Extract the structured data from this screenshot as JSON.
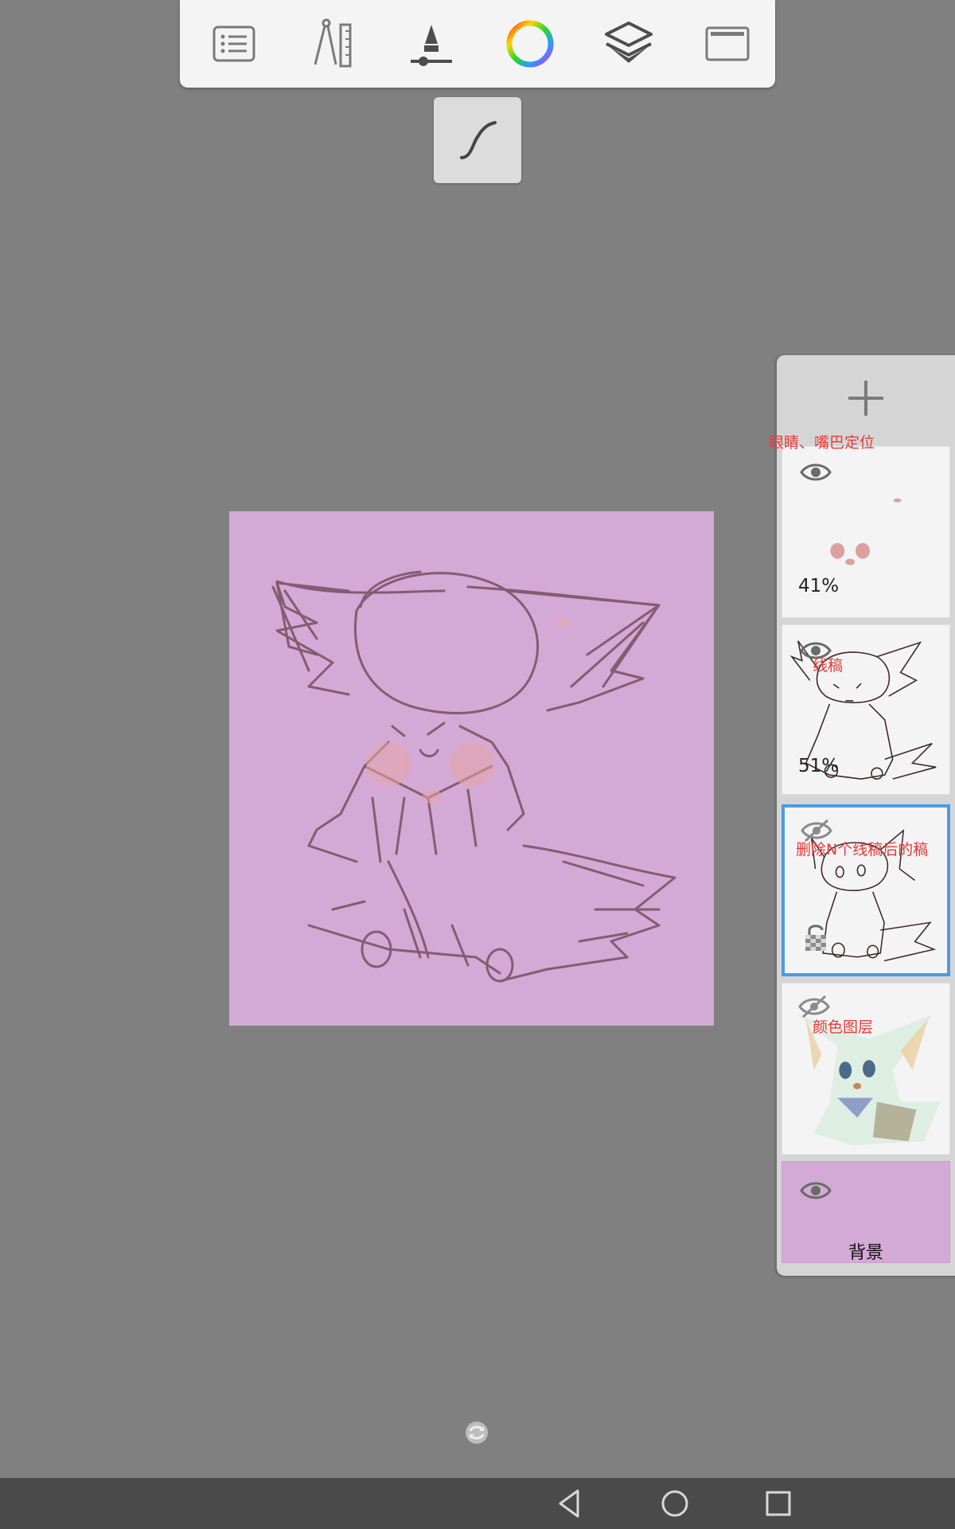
{
  "toolbar": {
    "items": [
      {
        "name": "menu-list-icon"
      },
      {
        "name": "ruler-compass-icon"
      },
      {
        "name": "brush-size-icon"
      },
      {
        "name": "color-wheel-icon"
      },
      {
        "name": "layers-icon"
      },
      {
        "name": "fullscreen-icon"
      }
    ],
    "sub_tool": "curve-stroke-icon"
  },
  "layers": {
    "add_icon": "plus-icon",
    "floating_label": "眼睛、嘴巴定位",
    "items": [
      {
        "opacity": "41%",
        "visible": true
      },
      {
        "name": "线稿",
        "opacity": "51%",
        "visible": true
      },
      {
        "name": "删除N个线稿后的稿",
        "visible": false,
        "locked": true,
        "selected": true
      },
      {
        "name": "颜色图层",
        "visible": false
      },
      {
        "name": "背景",
        "visible": true,
        "color": "#d3a9d5"
      }
    ]
  },
  "colors": {
    "canvas_bg": "#d3a9d5",
    "workspace": "#808080",
    "selected_border": "#4a9be0",
    "layer_name": "#e83a3a"
  }
}
